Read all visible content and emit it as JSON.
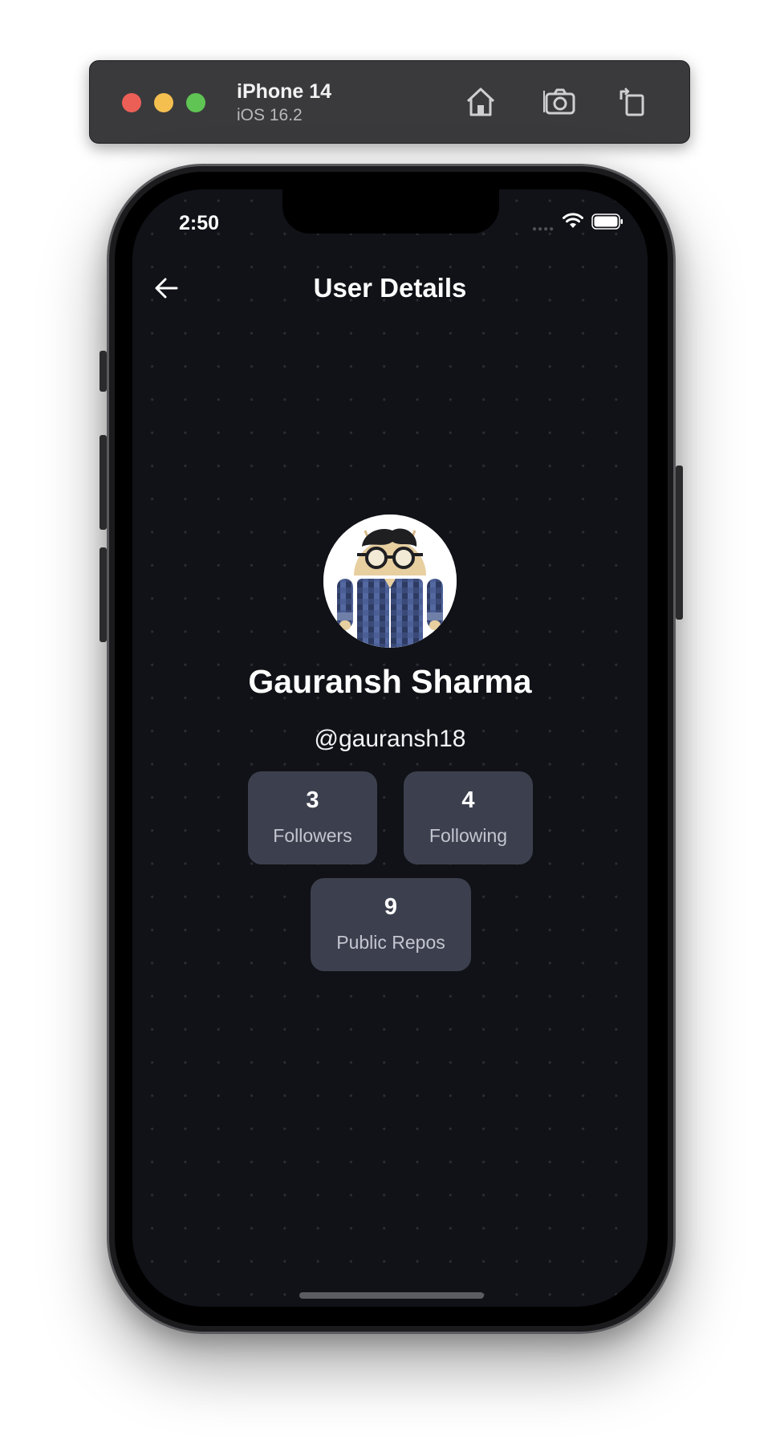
{
  "simulator": {
    "device_name": "iPhone 14",
    "os_version": "iOS 16.2",
    "toolbar_icons": [
      "home-icon",
      "screenshot-icon",
      "rotate-icon"
    ],
    "traffic_light_colors": [
      "#ec5f57",
      "#f4bf4f",
      "#5fc454"
    ]
  },
  "status_bar": {
    "time": "2:50",
    "icons": [
      "wifi-icon",
      "battery-icon"
    ]
  },
  "header": {
    "title": "User Details",
    "back_icon": "arrow-left-icon"
  },
  "profile": {
    "name": "Gauransh Sharma",
    "handle": "@gauransh18"
  },
  "stats": {
    "followers": {
      "count": "3",
      "label": "Followers"
    },
    "following": {
      "count": "4",
      "label": "Following"
    },
    "repos": {
      "count": "9",
      "label": "Public Repos"
    }
  },
  "colors": {
    "background": "#111217",
    "card": "#3c404e",
    "text_primary": "#ffffff",
    "text_secondary": "#c3c6cf"
  }
}
